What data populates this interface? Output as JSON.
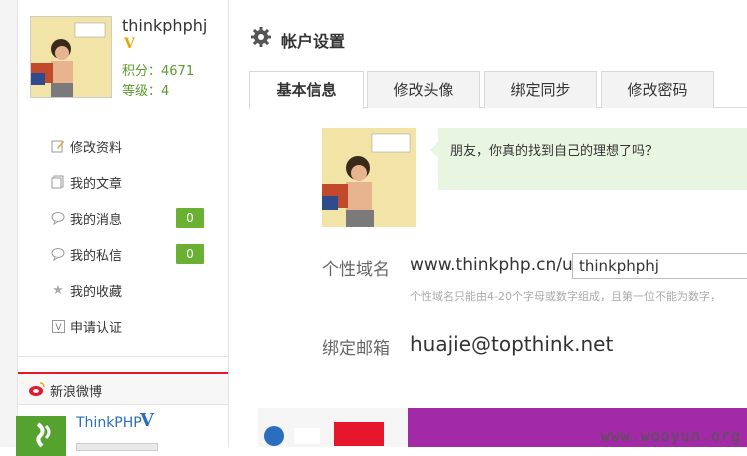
{
  "user": {
    "name": "thinkphphj",
    "verified_glyph": "V",
    "points_label": "积分：4671",
    "level_label": "等级：4"
  },
  "menu": [
    {
      "label": "修改资料",
      "icon": "edit-icon",
      "count": null
    },
    {
      "label": "我的文章",
      "icon": "document-icon",
      "count": null
    },
    {
      "label": "我的消息",
      "icon": "message-icon",
      "count": "0"
    },
    {
      "label": "我的私信",
      "icon": "chat-icon",
      "count": "0"
    },
    {
      "label": "我的收藏",
      "icon": "star-icon",
      "count": null
    },
    {
      "label": "申请认证",
      "icon": "verify-icon",
      "count": null
    }
  ],
  "weibo": {
    "title": "新浪微博",
    "account_name": "ThinkPHP",
    "verified_glyph": "V"
  },
  "page": {
    "title": "帐户设置",
    "tabs": [
      {
        "label": "基本信息",
        "active": true
      },
      {
        "label": "修改头像",
        "active": false
      },
      {
        "label": "绑定同步",
        "active": false
      },
      {
        "label": "修改密码",
        "active": false
      }
    ]
  },
  "profile": {
    "bubble_text": "朋友，你真的找到自己的理想了吗？",
    "domain_label": "个性域名",
    "domain_prefix": "www.thinkphp.cn/u/",
    "domain_value": "thinkphphj",
    "domain_hint": "个性域名只能由4-20个字母或数字组成，且第一位不能为数字，",
    "email_label": "绑定邮箱",
    "email_value": "huajie@topthink.net"
  },
  "banner": {
    "watermark": "www.wooyun.org"
  },
  "colors": {
    "accent_green": "#6ab033",
    "bubble_bg": "#e8f6e1",
    "weibo_red": "#e6162d",
    "link_blue": "#2a6fbd"
  }
}
